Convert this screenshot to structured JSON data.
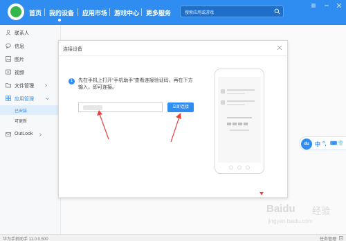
{
  "topbar": {
    "nav": [
      "首页",
      "我的设备",
      "应用市场",
      "游戏中心",
      "更多服务"
    ],
    "active_index": 1,
    "search_placeholder": "搜索应用或游戏"
  },
  "sidebar": {
    "items": [
      {
        "label": "联系人",
        "icon": "contacts-icon"
      },
      {
        "label": "信息",
        "icon": "message-icon"
      },
      {
        "label": "图片",
        "icon": "image-icon"
      },
      {
        "label": "视频",
        "icon": "video-icon"
      },
      {
        "label": "文件管理",
        "icon": "folder-icon"
      },
      {
        "label": "应用管理",
        "icon": "apps-icon"
      }
    ],
    "sub_items": [
      "已安装",
      "可更新"
    ],
    "outlook": "OutLook"
  },
  "dialog": {
    "title": "连接设备",
    "info_mark": "1",
    "instruction": "先在手机上打开“手机助手”查看连接验证码，再在下方输入，即可连接。",
    "connect_button": "立即连接"
  },
  "floating_toolbar": {
    "logo": "du",
    "items": [
      "中",
      "°,",
      "⌨",
      "👕"
    ]
  },
  "watermark": {
    "brand": "Baidu",
    "brand_cn": "经验",
    "url": "jingyan.baidu.com"
  },
  "statusbar": {
    "app_version": "华为手机助手 11.0.0.500",
    "task_manager": "任务管理"
  },
  "colors": {
    "primary": "#2f8cf0",
    "topbar": "#2f8cf0",
    "arrow_red": "#e8403b"
  }
}
